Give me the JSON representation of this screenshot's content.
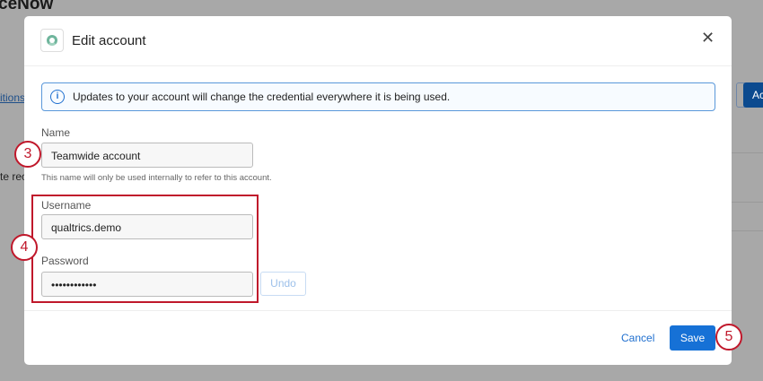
{
  "background": {
    "title": "ceNow",
    "link": "itions",
    "text": "te rec",
    "button": "Ac"
  },
  "modal": {
    "title": "Edit account",
    "info": "Updates to your account will change the credential everywhere it is being used.",
    "name": {
      "label": "Name",
      "value": "Teamwide account",
      "help": "This name will only be used internally to refer to this account."
    },
    "username": {
      "label": "Username",
      "value": "qualtrics.demo"
    },
    "password": {
      "label": "Password",
      "value": "••••••••••••"
    },
    "undo": "Undo",
    "cancel": "Cancel",
    "save": "Save"
  },
  "steps": [
    "3",
    "4",
    "5"
  ],
  "colors": {
    "accent": "#1671d6",
    "callout": "#c0182b"
  }
}
